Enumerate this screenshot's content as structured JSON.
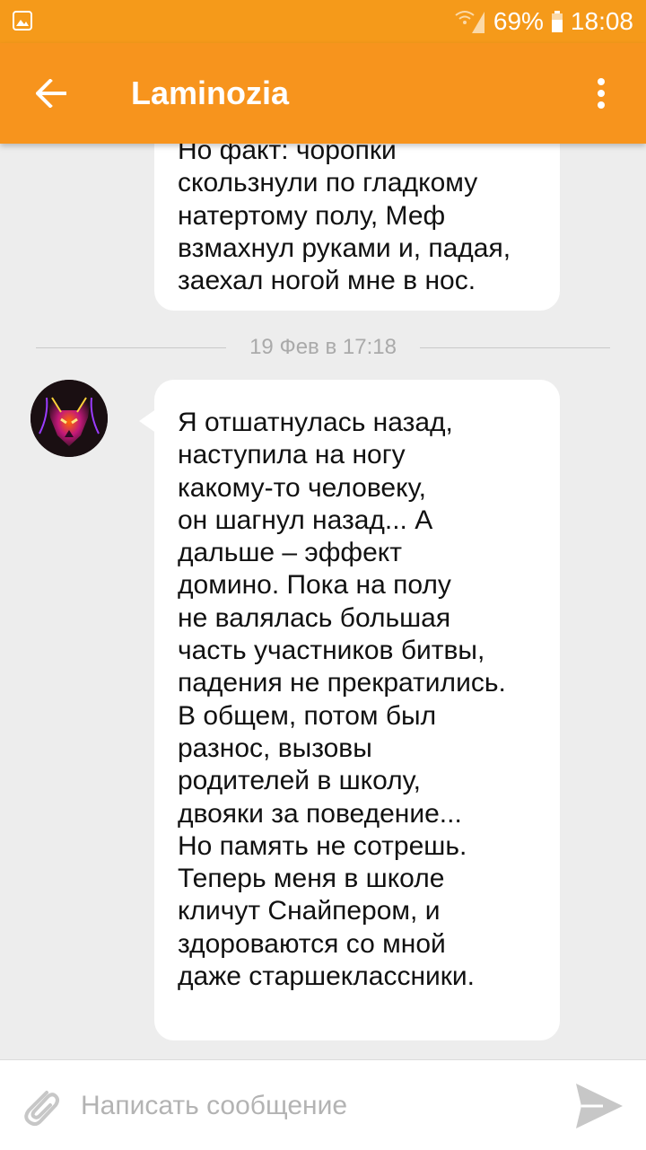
{
  "status_bar": {
    "battery_percent": "69%",
    "time": "18:08",
    "icons": [
      "gallery-notification-icon",
      "wifi-icon",
      "cellular-signal-icon",
      "battery-icon"
    ]
  },
  "app_bar": {
    "title": "Laminozia",
    "back_icon": "arrow-left-icon",
    "menu_icon": "more-vertical-icon",
    "color": "#f7941d"
  },
  "messages": [
    {
      "text": "Но факт: чоропки\nскользнули по гладкому\nнатертому полу, Меф\nвзмахнул руками и, падая,\nзаехал ногой мне в нос."
    },
    {
      "date": "19 Фев в 17:18",
      "text": "Я отшатнулась назад,\nнаступила на ногу\nкакому-то человеку,\nон шагнул назад... А\nдальше – эффект\nдомино. Пока на полу\nне валялась большая\nчасть участников битвы,\nпадения не прекратились.\nВ общем, потом был\nразнос, вызовы\nродителей в школу,\nдвояки за поведение...\nНо память не сотрешь.\nТеперь меня в школе\nкличут Снайпером, и\nздороваются со мной\nдаже старшеклассники."
    }
  ],
  "input": {
    "placeholder": "Написать сообщение",
    "value": "",
    "attach_icon": "paperclip-icon",
    "send_icon": "send-icon"
  }
}
